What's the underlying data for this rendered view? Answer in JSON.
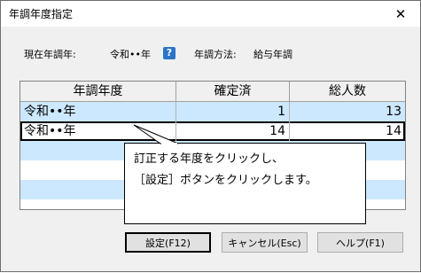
{
  "window": {
    "title": "年調年度指定",
    "close_glyph": "✕"
  },
  "info": {
    "current_year_label": "現在年調年:",
    "current_year_value": "令和••年",
    "help_glyph": "?",
    "method_label": "年調方法:",
    "method_value": "給与年調"
  },
  "table": {
    "columns": [
      "年調年度",
      "確定済",
      "総人数"
    ],
    "rows": [
      {
        "year": "令和••年",
        "confirmed": "1",
        "total": "13"
      },
      {
        "year": "令和••年",
        "confirmed": "14",
        "total": "14"
      }
    ],
    "selected_row": 1
  },
  "callout": {
    "line1": "訂正する年度をクリックし、",
    "line2": "［設定］ボタンをクリックします。"
  },
  "buttons": {
    "settings": "設定(F12)",
    "cancel": "キャンセル(Esc)",
    "help": "ヘルプ(F1)"
  },
  "colors": {
    "alt_row": "#cce8ff",
    "help_icon": "#2a74c9"
  }
}
